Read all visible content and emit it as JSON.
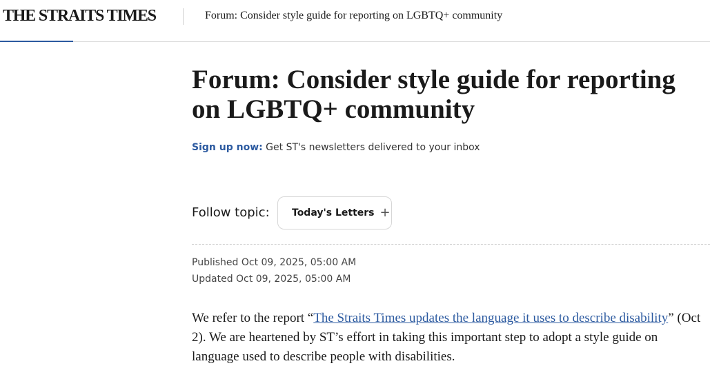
{
  "header": {
    "logo": "THE STRAITS TIMES",
    "title": "Forum: Consider style guide for reporting on LGBTQ+ community"
  },
  "article": {
    "headline": "Forum: Consider style guide for reporting on LGBTQ+ community",
    "signup_link": "Sign up now:",
    "signup_text": " Get ST's newsletters delivered to your inbox",
    "follow_label": "Follow topic:",
    "topic_label": "Today's Letters",
    "topic_icon": "plus-icon",
    "published": "Published Oct 09, 2025, 05:00 AM",
    "updated": "Updated Oct 09, 2025, 05:00 AM",
    "body_before": "We refer to the report “",
    "body_link": "The Straits Times updates the language it uses to describe disability",
    "body_after": "” (Oct 2). We are heartened by ST’s effort in taking this important step to adopt a style guide on language used to describe people with disabilities."
  },
  "colors": {
    "accent": "#2c5aa0",
    "text": "#1a1a1a"
  }
}
